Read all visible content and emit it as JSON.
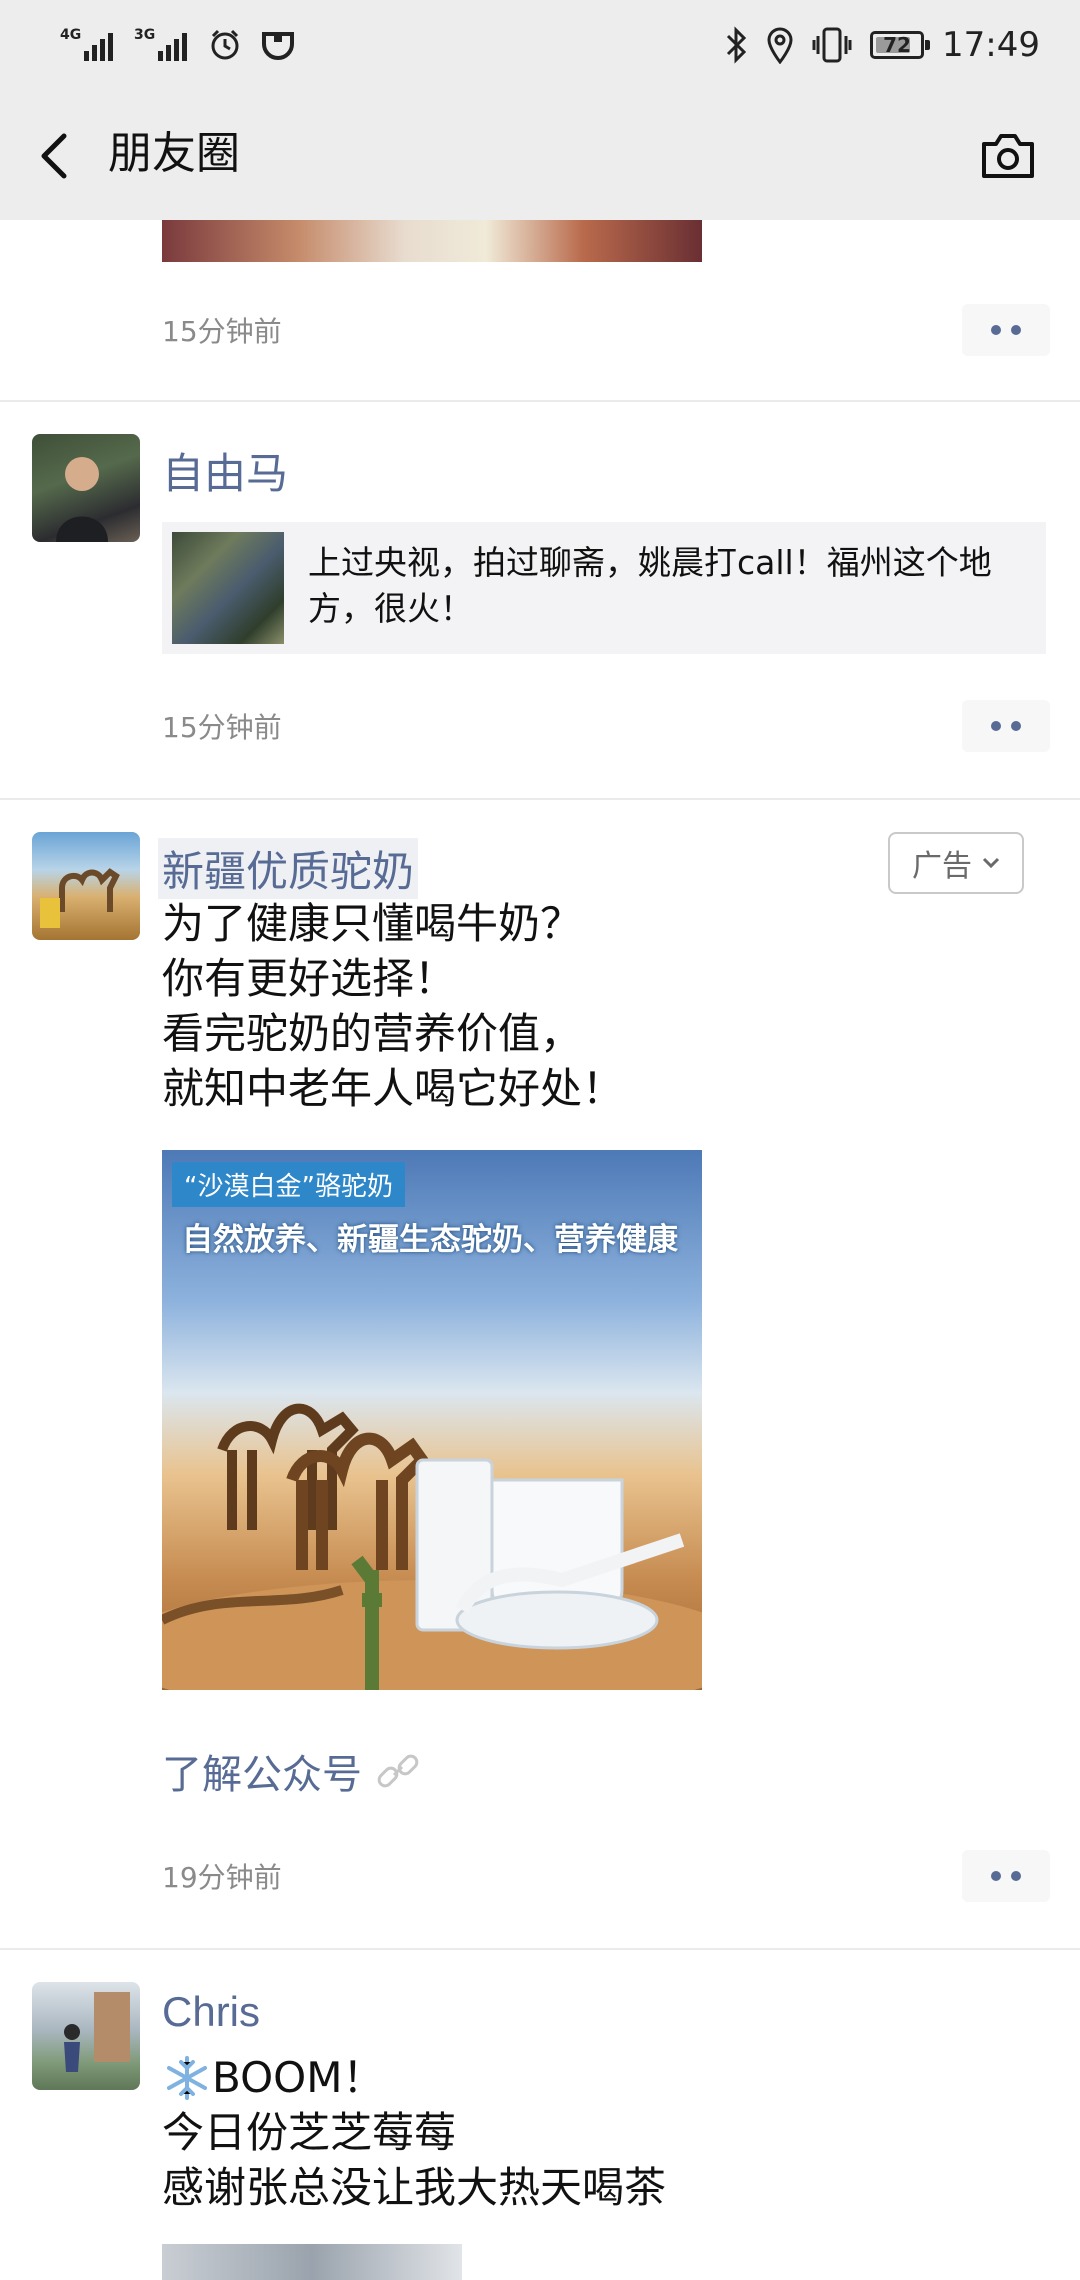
{
  "status_bar": {
    "signal1_label": "4G",
    "signal2_label": "3G",
    "battery": "72",
    "time": "17:49"
  },
  "nav": {
    "title": "朋友圈"
  },
  "posts": [
    {
      "time": "15分钟前"
    },
    {
      "name": "自由马",
      "share_text": "上过央视，拍过聊斋，姚晨打call！福州这个地方，很火！",
      "time": "15分钟前"
    },
    {
      "name": "新疆优质驼奶",
      "ad_label": "广告",
      "lines": [
        "为了健康只懂喝牛奶？",
        "你有更好选择！",
        "看完驼奶的营养价值，",
        "就知中老年人喝它好处！"
      ],
      "image_banner1": "“沙漠白金”骆驼奶",
      "image_banner2": "自然放养、新疆生态驼奶、营养健康",
      "link_text": "了解公众号",
      "time": "19分钟前"
    },
    {
      "name": "Chris",
      "lines": [
        "BOOM！",
        "今日份芝芝莓莓",
        "感谢张总没让我大热天喝茶"
      ]
    }
  ]
}
